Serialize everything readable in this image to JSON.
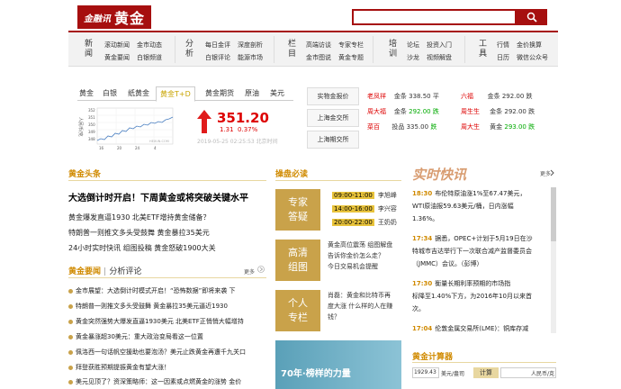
{
  "logo": {
    "small": "金融讯",
    "big": "黄金"
  },
  "nav": [
    {
      "cat": "新闻",
      "links": [
        "滚动新闻",
        "金市动态",
        "黄金要闻",
        "白银频道"
      ]
    },
    {
      "cat": "分析",
      "links": [
        "每日金评",
        "深度剖析",
        "白银评论",
        "能源市场"
      ]
    },
    {
      "cat": "栏目",
      "links": [
        "高端访谈",
        "专家专栏",
        "金市图说",
        "黄金专题"
      ]
    },
    {
      "cat": "培训",
      "links": [
        "论坛",
        "投资入门",
        "沙龙",
        "视频解盘"
      ]
    },
    {
      "cat": "工具",
      "links": [
        "行情",
        "金价换算",
        "日历",
        "微信公众号"
      ]
    }
  ],
  "tabs": [
    "黄金",
    "白银",
    "纸黄金",
    "黄金T+D",
    "黄金期货",
    "原油",
    "美元"
  ],
  "chart": {
    "ylabel": "人民币/克",
    "yticks": [
      "352",
      "351",
      "350",
      "349",
      "348"
    ],
    "xticks": [
      "16",
      "20",
      "24",
      "4"
    ],
    "watermark": "HEXUN.COM"
  },
  "quote": {
    "price": "351.20",
    "change": "1.31",
    "pct": "0.37%",
    "time": "2019-05-25 02:25:53 北京时间"
  },
  "exchanges": [
    "实物金报价",
    "上海金交所",
    "上海期交所"
  ],
  "quotes": [
    {
      "name": "老凤祥",
      "metal": "金条",
      "value": "338.50",
      "trend": "平",
      "c": "red"
    },
    {
      "name": "周大福",
      "metal": "金条",
      "value": "292.00",
      "trend": "跌",
      "c": "grn"
    },
    {
      "name": "菜百",
      "metal": "投品",
      "value": "335.00",
      "trend": "跌",
      "c": "grn"
    },
    {
      "name": "六福",
      "metal": "金条",
      "value": "292.00",
      "trend": "跌",
      "c": "red"
    },
    {
      "name": "周生生",
      "metal": "金条",
      "value": "292.00",
      "trend": "跌",
      "c": "red"
    },
    {
      "name": "周大生",
      "metal": "黄金",
      "value": "293.00",
      "trend": "跌",
      "c": "grn"
    },
    {
      "name": "",
      "metal": "金条",
      "value": "292.00",
      "trend": "",
      "c": "red"
    },
    {
      "name": "",
      "metal": "金条",
      "value": "292.00",
      "trend": "跌",
      "c": "red"
    }
  ],
  "headlines": {
    "title": "黄金头条",
    "main": "大选倒计时开启！下周黄金或将突破关键水平",
    "items": [
      "黄金爆发直逼1930 北美ETF增持黄金储备？",
      "特朗普一则推文多头受鼓舞 黄金暴拉35美元",
      "24小时实时快讯 组图投稿 黄金怒破1900大关"
    ]
  },
  "important": {
    "title": "黄金要闻",
    "sub": "分析评论",
    "more": "更多",
    "items": [
      "金市展望：大选倒计时模式开启！“恐怖数据”即将来袭 下",
      "特朗普一则推文多头受鼓舞 黄金暴拉35美元逼近1930",
      "黄金突然强势大爆发直逼1930美元 北美ETF正悄悄大幅增持",
      "黄金暴涨超30美元：重大政治变局看这一位置",
      "佩洛西一句话帆空援助也要泡汤？美元止跌黄金再遭千九关口",
      "拜登获胜预期提振黄金有望大涨！",
      "美元见顶了？资深策略师：这一因素或点燃黄金的涨势 金价"
    ]
  },
  "analysis": {
    "title": "操盘必读",
    "tiles": [
      [
        "专家",
        "答疑"
      ],
      [
        "高清",
        "组图"
      ],
      [
        "个人",
        "专栏"
      ]
    ],
    "live": [
      {
        "time": "09:00-11:00",
        "name": "李旭峰"
      },
      {
        "time": "14:00-16:00",
        "name": "李兴容"
      },
      {
        "time": "20:00-22:00",
        "name": "王奶奶"
      }
    ],
    "text1": [
      "黄金高位震荡 组图解盘",
      "告诉你金价怎么走？",
      "今日交易机会提醒"
    ],
    "text2": [
      "肖磊：黄金和比特币再",
      "度大涨 什么样的人在赚",
      "钱？"
    ],
    "banner": "70年·榜样的力量"
  },
  "realtime": {
    "title": "实时快讯",
    "more": "更多",
    "items": [
      {
        "t": "18:30",
        "lines": [
          "布伦特原油涨1%至67.47美元，",
          "WTI原油报59.63美元/桶，日内涨幅",
          "1.36%。"
        ]
      },
      {
        "t": "17:34",
        "lines": [
          "据悉，OPEC+计划于5月19日在沙",
          "特城市吉达举行下一次联合减产监督委员会",
          "（JMMC）会议。（彭博）"
        ]
      },
      {
        "t": "17:30",
        "lines": [
          "衡量长期利率预期的市场指",
          "标降至1.40%下方，为2016年10月以来首",
          "次。"
        ]
      },
      {
        "t": "17:04",
        "lines": [
          "伦敦金属交易所(LME)：铜库存减"
        ]
      }
    ]
  },
  "calculator": {
    "title": "黄金计算器",
    "input": "1929.43",
    "unit": "美元/盎司",
    "btn": "计算",
    "target": "人民币/克"
  }
}
